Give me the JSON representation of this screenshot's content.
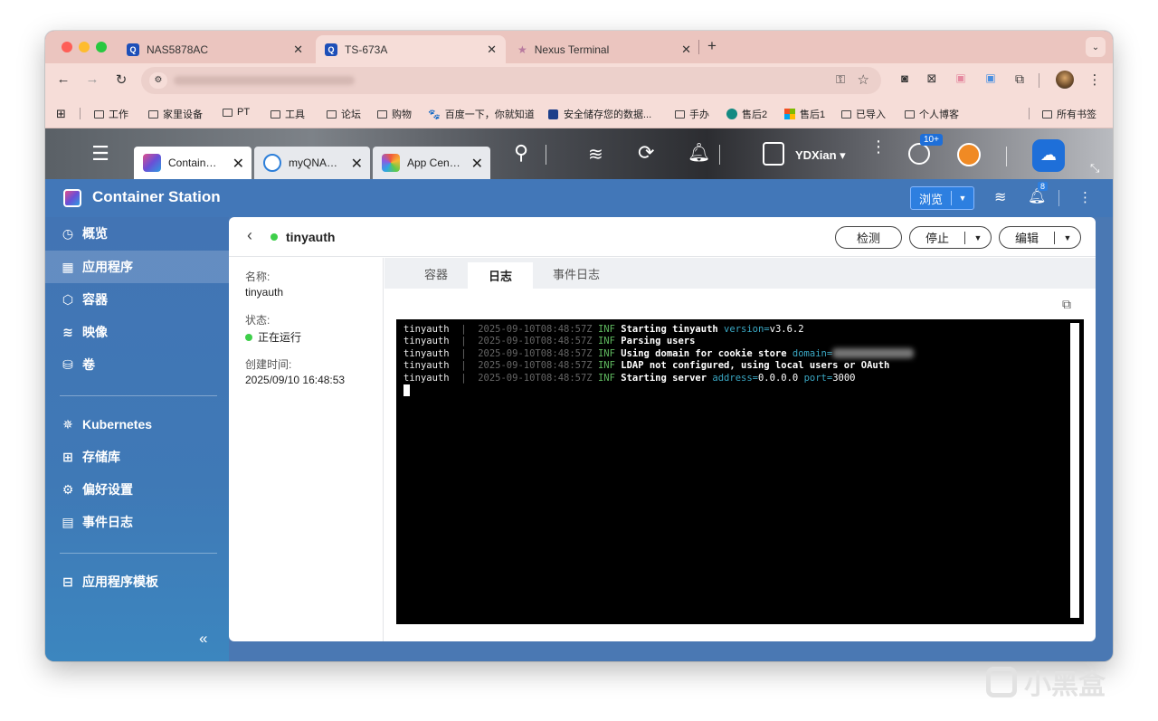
{
  "browser_tabs": [
    {
      "label": "NAS5878AC"
    },
    {
      "label": "TS-673A"
    },
    {
      "label": "Nexus Terminal"
    }
  ],
  "bookmarks": [
    "工作",
    "家里设备",
    "PT",
    "工具",
    "论坛",
    "购物",
    "百度一下，你就知道",
    "安全储存您的数据...",
    "手办",
    "售后2",
    "售后1",
    "已导入",
    "个人博客",
    "所有书签"
  ],
  "qnap": {
    "tabs": [
      {
        "label": "Contain…"
      },
      {
        "label": "myQNA…"
      },
      {
        "label": "App Cen…"
      }
    ],
    "user": "YDXian ▾",
    "badge": "10+"
  },
  "station": {
    "title": "Container Station",
    "browse_label": "浏览",
    "notif_count": "8"
  },
  "sidebar": {
    "items": [
      {
        "label": "概览"
      },
      {
        "label": "应用程序"
      },
      {
        "label": "容器"
      },
      {
        "label": "映像"
      },
      {
        "label": "卷"
      },
      {
        "label": "Kubernetes"
      },
      {
        "label": "存储库"
      },
      {
        "label": "偏好设置"
      },
      {
        "label": "事件日志"
      },
      {
        "label": "应用程序模板"
      }
    ],
    "collapse": "«"
  },
  "app": {
    "name": "tinyauth",
    "buttons": {
      "detect": "检测",
      "stop": "停止",
      "edit": "编辑"
    },
    "info": {
      "name_label": "名称:",
      "name_value": "tinyauth",
      "status_label": "状态:",
      "status_value": "正在运行",
      "created_label": "创建时间:",
      "created_value": "2025/09/10 16:48:53"
    },
    "tabs": [
      {
        "label": "容器"
      },
      {
        "label": "日志"
      },
      {
        "label": "事件日志"
      }
    ]
  },
  "log_lines": [
    {
      "svc": "tinyauth",
      "ts": "2025-09-10T08:48:57Z",
      "level": "INF",
      "msg": "Starting tinyauth",
      "k1": "version=",
      "v1": "v3.6.2",
      "k2": "",
      "v2": ""
    },
    {
      "svc": "tinyauth",
      "ts": "2025-09-10T08:48:57Z",
      "level": "INF",
      "msg": "Parsing users",
      "k1": "",
      "v1": "",
      "k2": "",
      "v2": ""
    },
    {
      "svc": "tinyauth",
      "ts": "2025-09-10T08:48:57Z",
      "level": "INF",
      "msg": "Using domain for cookie store",
      "k1": "domain=",
      "v1": "",
      "k2": "",
      "v2": ""
    },
    {
      "svc": "tinyauth",
      "ts": "2025-09-10T08:48:57Z",
      "level": "INF",
      "msg": "LDAP not configured, using local users or OAuth",
      "k1": "",
      "v1": "",
      "k2": "",
      "v2": ""
    },
    {
      "svc": "tinyauth",
      "ts": "2025-09-10T08:48:57Z",
      "level": "INF",
      "msg": "Starting server",
      "k1": "address=",
      "v1": "0.0.0.0",
      "k2": "port=",
      "v2": "3000"
    }
  ],
  "watermark": "小黑盒"
}
